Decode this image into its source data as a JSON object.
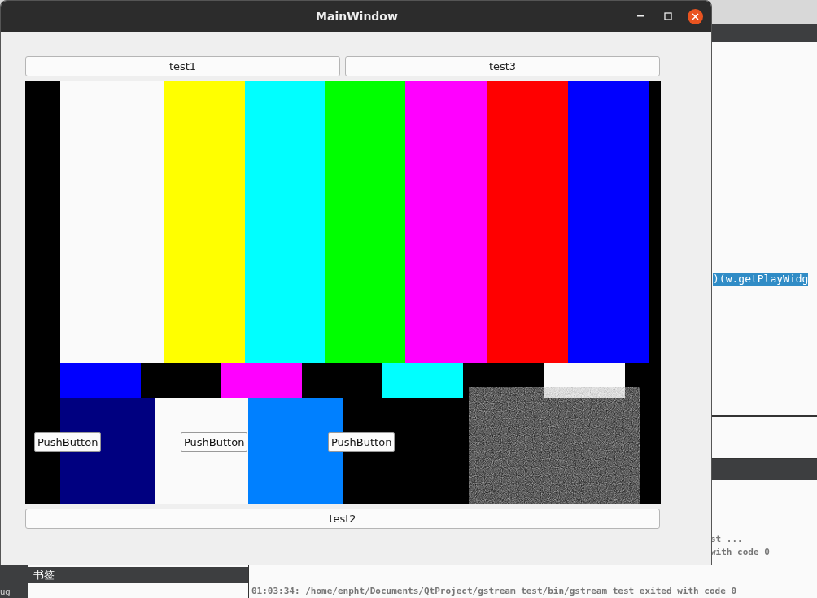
{
  "window": {
    "title": "MainWindow"
  },
  "top_buttons": [
    "test1",
    "test3"
  ],
  "video": {
    "kind": "picture",
    "overlay_buttons": [
      "PushButton",
      "PushButton",
      "PushButton"
    ]
  },
  "bottom_button": "test2",
  "background_app": {
    "editor_selected_line": ")(w.getPlayWidg",
    "bookmarks_title": "书签",
    "side_label": "ug",
    "output_tails": [
      "st ...",
      "with code 0"
    ],
    "output_lines": [
      "01:03:34: /home/enpht/Documents/QtProject/gstream_test/bin/gstream_test exited with code 0"
    ]
  }
}
